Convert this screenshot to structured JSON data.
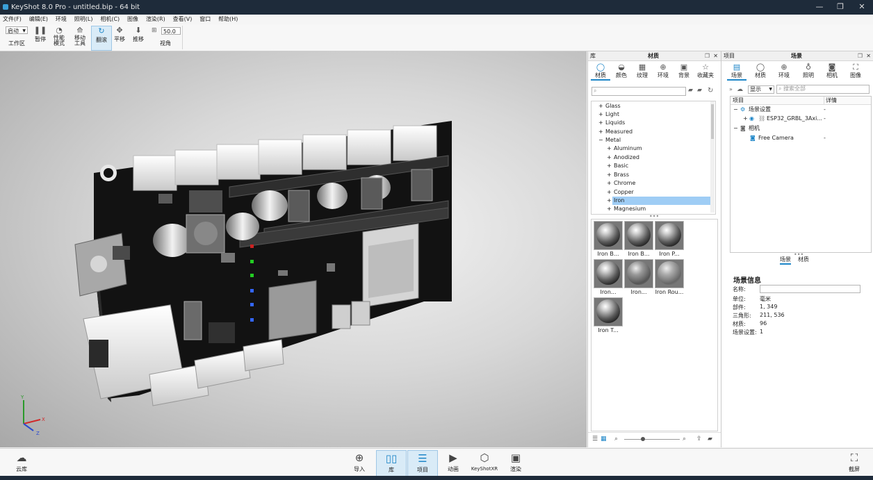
{
  "window": {
    "title": "KeyShot 8.0 Pro  - untitled.bip  - 64 bit",
    "minimize": "—",
    "restore": "❐",
    "close": "✕"
  },
  "menu": [
    "文件(F)",
    "编辑(E)",
    "环境",
    "照明(L)",
    "相机(C)",
    "图像",
    "渲染(R)",
    "查看(V)",
    "窗口",
    "帮助(H)"
  ],
  "toolbar": {
    "startup_value": "启动",
    "workspace_label": "工作区",
    "pause_label": "暂停",
    "performance_label": "性能\n模式",
    "move_tool_label": "移动\n工具",
    "tumble_label": "翻滚",
    "pan_label": "平移",
    "dolly_label": "推移",
    "fov_value": "50.0",
    "view_label": "视角"
  },
  "library": {
    "panel_left_label": "库",
    "panel_title": "材质",
    "tabs": [
      "材质",
      "颜色",
      "纹理",
      "环境",
      "背景",
      "收藏夹"
    ],
    "tree": [
      {
        "label": "Glass",
        "level": 0,
        "expander": "+",
        "selected": false
      },
      {
        "label": "Light",
        "level": 0,
        "expander": "+",
        "selected": false
      },
      {
        "label": "Liquids",
        "level": 0,
        "expander": "+",
        "selected": false
      },
      {
        "label": "Measured",
        "level": 0,
        "expander": "+",
        "selected": false
      },
      {
        "label": "Metal",
        "level": 0,
        "expander": "−",
        "selected": false
      },
      {
        "label": "Aluminum",
        "level": 1,
        "expander": "+",
        "selected": false
      },
      {
        "label": "Anodized",
        "level": 1,
        "expander": "+",
        "selected": false
      },
      {
        "label": "Basic",
        "level": 1,
        "expander": "+",
        "selected": false
      },
      {
        "label": "Brass",
        "level": 1,
        "expander": "+",
        "selected": false
      },
      {
        "label": "Chrome",
        "level": 1,
        "expander": "+",
        "selected": false
      },
      {
        "label": "Copper",
        "level": 1,
        "expander": "+",
        "selected": false
      },
      {
        "label": "Iron",
        "level": 1,
        "expander": "+",
        "selected": true
      },
      {
        "label": "Magnesium",
        "level": 1,
        "expander": "+",
        "selected": false
      }
    ],
    "thumbnails": [
      "Iron B...",
      "Iron B...",
      "Iron P...",
      "Iron...",
      "Iron...",
      "Iron Rou...",
      "Iron T..."
    ]
  },
  "project": {
    "panel_left_label": "项目",
    "panel_title": "场景",
    "tabs": [
      "场景",
      "材质",
      "环境",
      "照明",
      "相机",
      "图像"
    ],
    "show_dropdown": "显示",
    "search_placeholder": "搜索全部",
    "col_item": "项目",
    "col_detail": "详情",
    "tree": [
      {
        "label": "场景设置",
        "detail": "-"
      },
      {
        "label": "ESP32_GRBL_3Axi...",
        "detail": "-"
      },
      {
        "label": "相机",
        "detail": ""
      },
      {
        "label": "Free Camera",
        "detail": "-"
      }
    ],
    "subtabs": [
      "场景",
      "材质"
    ],
    "info": {
      "title": "场景信息",
      "name_label": "名称:",
      "unit_label": "单位:",
      "unit_value": "毫米",
      "parts_label": "部件:",
      "parts_value": "1, 349",
      "tris_label": "三角形:",
      "tris_value": "211, 536",
      "materials_label": "材质:",
      "materials_value": "96",
      "scene_sets_label": "场景设置:",
      "scene_sets_value": "1"
    }
  },
  "viewport": {
    "axis_x": "X",
    "axis_y": "Y",
    "axis_z": "Z"
  },
  "bottombar": {
    "cloud_label": "云库",
    "import_label": "导入",
    "library_label": "库",
    "project_label": "项目",
    "animation_label": "动画",
    "keyshotxr_label": "KeyShotXR",
    "render_label": "渲染",
    "screenshot_label": "截屏"
  },
  "colors": {
    "accent": "#1e86c8",
    "selection": "#9fcdf5",
    "titlebar": "#1e2b3a",
    "pcb": "#161616"
  }
}
